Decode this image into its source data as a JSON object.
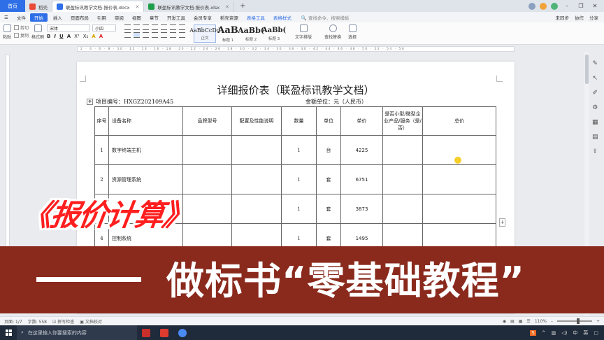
{
  "tabs": {
    "home": "首页",
    "items": [
      {
        "label": "稻壳",
        "color": "#e94a35"
      },
      {
        "label": "联盈标讯教学文档-报价表.docx",
        "color": "#2e6fe8"
      },
      {
        "label": "联盈标讯教学文档-报价表.xlsx",
        "color": "#1f9e4a"
      }
    ],
    "add": "+"
  },
  "window_controls": {
    "minimize": "–",
    "restore": "❐",
    "close": "✕"
  },
  "menu": {
    "file": "文件",
    "items": [
      "开始",
      "插入",
      "页面布局",
      "引用",
      "审阅",
      "视图",
      "章节",
      "开发工具",
      "会员专享",
      "稻壳资源"
    ],
    "blue_items": [
      "表格工具",
      "表格样式"
    ],
    "search": "查找命令、搜索模板",
    "right": [
      "未同步",
      "协作",
      "分享"
    ]
  },
  "ribbon": {
    "paste": "粘贴",
    "cut": "剪切",
    "copy": "复制",
    "format_painter": "格式刷",
    "font_name": "宋体",
    "font_size": "小四",
    "format_buttons": [
      "B",
      "I",
      "U",
      "A",
      "X²",
      "X₂",
      "A",
      "A"
    ],
    "styles": [
      {
        "preview": "AaBbCcDd",
        "label": "正文",
        "size": "8px"
      },
      {
        "preview": "AaB",
        "label": "标题 1",
        "size": "13px"
      },
      {
        "preview": "AaBb(",
        "label": "标题 2",
        "size": "11px"
      },
      {
        "preview": "AaBb(",
        "label": "标题 3",
        "size": "10px"
      }
    ],
    "text_layout": "文字排版",
    "find_replace": "查找替换",
    "select": "选择"
  },
  "ruler": "2 · 4 · 6 · 8 · 10 · 12 · 14 · 16 · 18 · 20 · 22 · 24 · 26 · 28 · 30 · 32 · 34 · 36 · 38 · 40 · 42 · 44 · 46 · 48 · 50 · 52 · 54 · 56",
  "document": {
    "title": "详细报价表（联盈标讯教学文档）",
    "project_no": "项目编号：HXGZ202109A45",
    "currency": "金额单位：元（人民币）",
    "table": {
      "headers": [
        "序号",
        "设备名称",
        "品牌型号",
        "配置及性能说明",
        "数量",
        "单位",
        "单价",
        "是否小型/微型企业产品/服务（是/否）",
        "总价"
      ],
      "rows": [
        {
          "no": "1",
          "name": "数字终端主机",
          "brand": "",
          "config": "",
          "qty": "1",
          "unit": "台",
          "price": "4225",
          "sme": "",
          "total": ""
        },
        {
          "no": "2",
          "name": "资源管理系统",
          "brand": "",
          "config": "",
          "qty": "1",
          "unit": "套",
          "price": "6751",
          "sme": "",
          "total": ""
        },
        {
          "no": "3",
          "name": "",
          "brand": "",
          "config": "",
          "qty": "1",
          "unit": "套",
          "price": "3873",
          "sme": "",
          "total": ""
        },
        {
          "no": "4",
          "name": "控制系统",
          "brand": "",
          "config": "",
          "qty": "1",
          "unit": "套",
          "price": "1495",
          "sme": "",
          "total": ""
        }
      ]
    }
  },
  "overlay": {
    "headline": "《报价计算》",
    "subtitle": "做标书“零基础教程”"
  },
  "status": {
    "page": "页面: 1/7",
    "words": "字数: 558",
    "spell": "拼写检查",
    "proof": "文档校对",
    "zoom": "110%"
  },
  "taskbar": {
    "search_placeholder": "在这里输入你要搜索的内容",
    "tray_lang": "中",
    "tray_ime": "英"
  }
}
